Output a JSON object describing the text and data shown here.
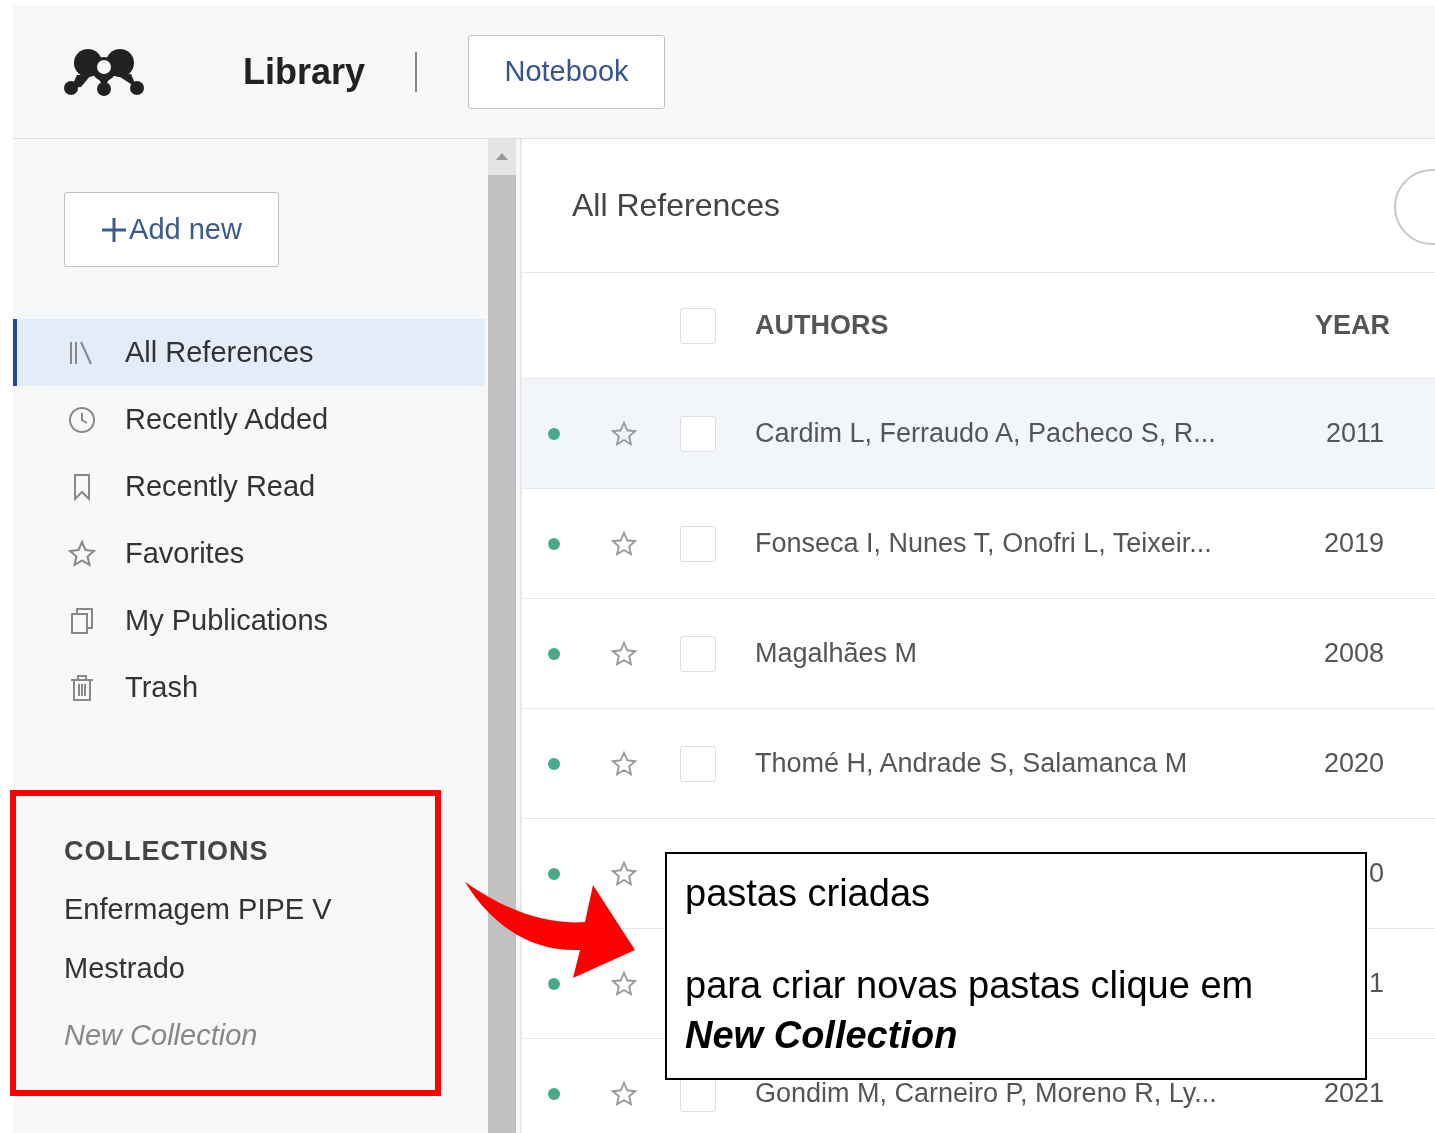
{
  "header": {
    "title": "Library",
    "notebook_button": "Notebook"
  },
  "sidebar": {
    "add_button": "Add new",
    "items": [
      {
        "label": "All References",
        "selected": true
      },
      {
        "label": "Recently Added",
        "selected": false
      },
      {
        "label": "Recently Read",
        "selected": false
      },
      {
        "label": "Favorites",
        "selected": false
      },
      {
        "label": "My Publications",
        "selected": false
      },
      {
        "label": "Trash",
        "selected": false
      }
    ],
    "collections_heading": "COLLECTIONS",
    "collections": [
      {
        "label": "Enfermagem PIPE V",
        "kind": "folder"
      },
      {
        "label": "Mestrado",
        "kind": "folder"
      },
      {
        "label": "New Collection",
        "kind": "new"
      }
    ]
  },
  "main": {
    "title": "All References",
    "select_all_checked": false,
    "columns": [
      "AUTHORS",
      "YEAR"
    ],
    "rows": [
      {
        "selected": true,
        "starred": false,
        "checked": false,
        "authors": "Cardim L, Ferraudo A, Pacheco S, R...",
        "year": "2011"
      },
      {
        "selected": false,
        "starred": false,
        "checked": false,
        "authors": "Fonseca I, Nunes T, Onofri L, Teixeir...",
        "year": "2019"
      },
      {
        "selected": false,
        "starred": false,
        "checked": false,
        "authors": "Magalhães M",
        "year": "2008"
      },
      {
        "selected": false,
        "starred": false,
        "checked": false,
        "authors": "Thomé H, Andrade S, Salamanca M",
        "year": "2020"
      },
      {
        "selected": false,
        "starred": false,
        "year": "0"
      },
      {
        "selected": false,
        "starred": false,
        "year": "1"
      },
      {
        "selected": false,
        "starred": false,
        "checked": false,
        "authors": "Gondim M, Carneiro P, Moreno R, Ly...",
        "year": "2021"
      }
    ]
  },
  "callout": {
    "lines": [
      "pastas criadas",
      "para criar novas pastas clique em **New Collection**"
    ]
  }
}
